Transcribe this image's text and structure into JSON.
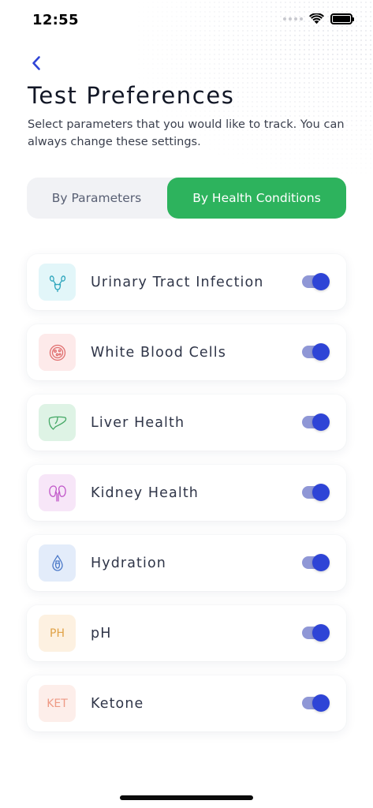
{
  "status_bar": {
    "time": "12:55"
  },
  "header": {
    "back_icon": "chevron-left-icon",
    "title": "Test Preferences",
    "subtitle": "Select parameters that you would like to track. You can always change these settings."
  },
  "tabs": [
    {
      "label": "By Parameters",
      "active": false
    },
    {
      "label": "By Health Conditions",
      "active": true
    }
  ],
  "colors": {
    "accent_green": "#2db35d",
    "toggle_on": "#2e44d6",
    "toggle_track": "#8f97d6",
    "back_arrow": "#2e44d6"
  },
  "conditions": [
    {
      "label": "Urinary Tract Infection",
      "icon": "urinary-tract-icon",
      "icon_bg": "#e2f6f9",
      "icon_color": "#2fa6bd",
      "enabled": true
    },
    {
      "label": "White Blood Cells",
      "icon": "blood-cell-icon",
      "icon_bg": "#fdeaea",
      "icon_color": "#e06f6f",
      "enabled": true
    },
    {
      "label": "Liver Health",
      "icon": "liver-icon",
      "icon_bg": "#def3e5",
      "icon_color": "#44a865",
      "enabled": true
    },
    {
      "label": "Kidney Health",
      "icon": "kidney-icon",
      "icon_bg": "#f7e6f8",
      "icon_color": "#c055c8",
      "enabled": true
    },
    {
      "label": "Hydration",
      "icon": "water-drop-icon",
      "icon_bg": "#e3ecfa",
      "icon_color": "#4a78c8",
      "enabled": true
    },
    {
      "label": "pH",
      "icon_text": "PH",
      "icon_bg": "#fdf1e1",
      "icon_color": "#e0a247",
      "enabled": true
    },
    {
      "label": "Ketone",
      "icon_text": "KET",
      "icon_bg": "#fdeeea",
      "icon_color": "#ee9a85",
      "enabled": true
    }
  ]
}
